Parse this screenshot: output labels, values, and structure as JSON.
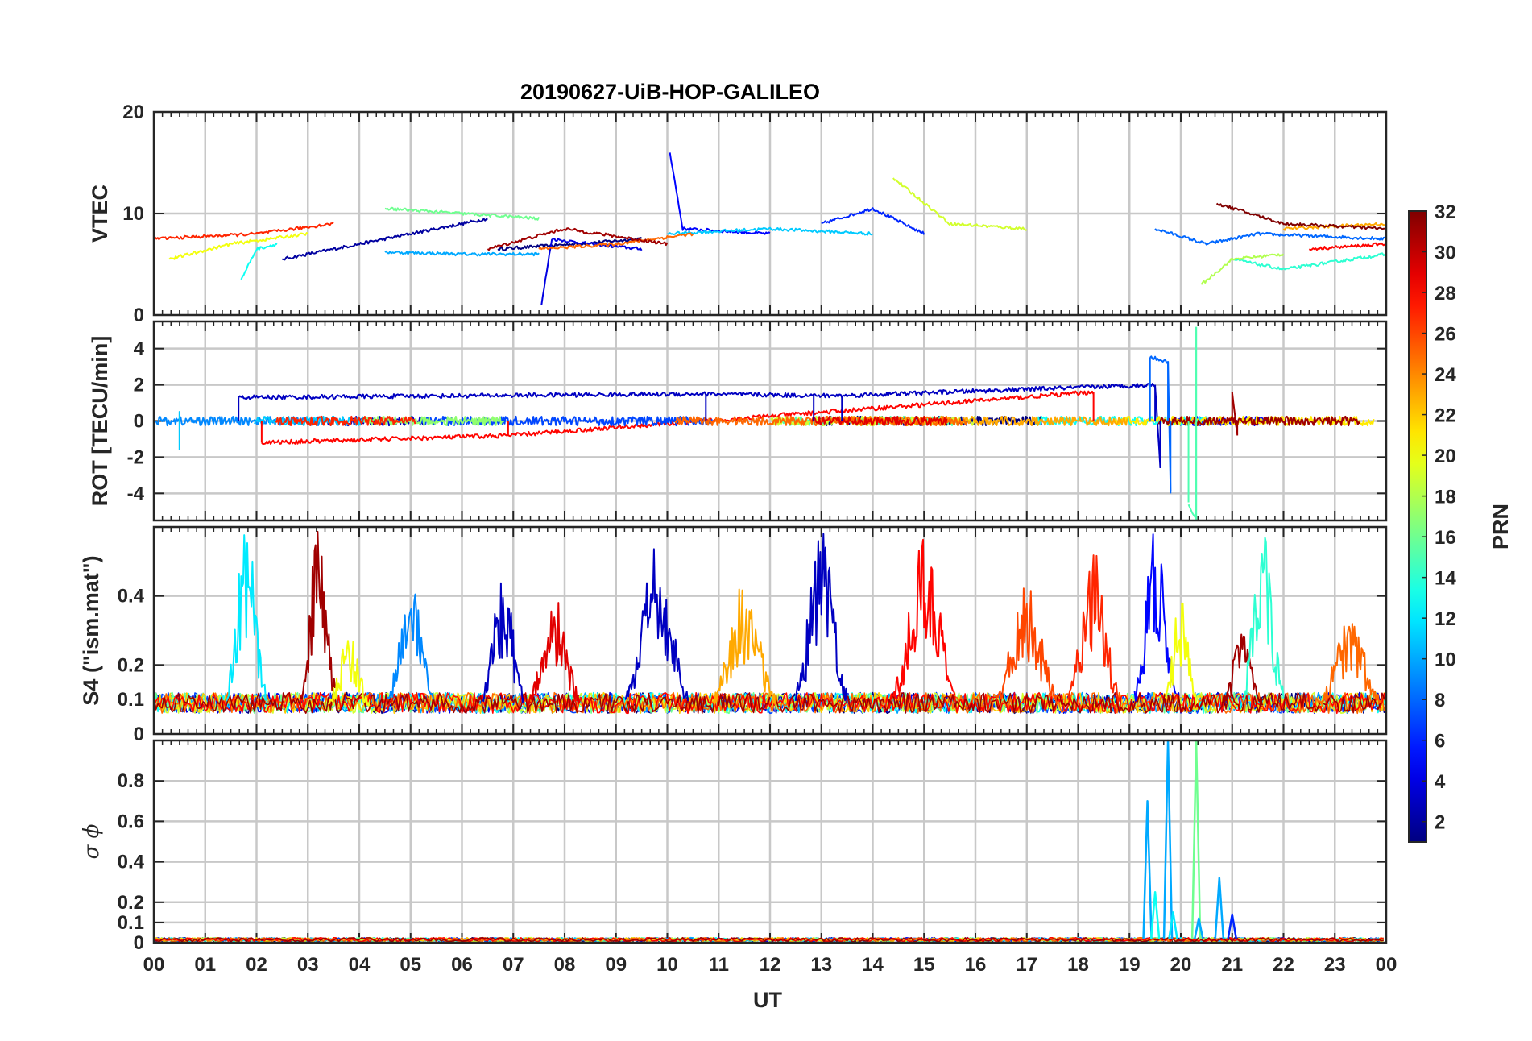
{
  "title": "20190627-UiB-HOP-GALILEO",
  "colors": {
    "background": "#ffffff",
    "axis": "#262626",
    "grid": "#c8c8c8",
    "colormap": "jet"
  },
  "chart_data": [
    {
      "type": "line",
      "panel": "VTEC",
      "ylabel": "VTEC",
      "ylim": [
        0,
        20
      ],
      "yticks": [
        "0",
        "10",
        "20"
      ],
      "xlim": [
        0,
        24
      ],
      "grid": true,
      "series": [
        {
          "prn": 1,
          "x": [
            6.7,
            8.2,
            9.5
          ],
          "y": [
            6.5,
            7.0,
            7.5
          ]
        },
        {
          "prn": 2,
          "x": [
            2.5,
            4.0,
            5.5,
            6.5
          ],
          "y": [
            5.5,
            7.0,
            8.5,
            9.5
          ]
        },
        {
          "prn": 4,
          "x": [
            7.55,
            7.75,
            8.5,
            9.5
          ],
          "y": [
            1.0,
            7.5,
            7.0,
            6.5
          ]
        },
        {
          "prn": 5,
          "x": [
            10.05,
            10.3,
            12.0
          ],
          "y": [
            16.0,
            8.5,
            8.0
          ]
        },
        {
          "prn": 6,
          "x": [
            13.0,
            14.0,
            15.0
          ],
          "y": [
            9.0,
            10.5,
            8.0
          ]
        },
        {
          "prn": 8,
          "x": [
            19.5,
            20.5,
            21.5,
            24.0
          ],
          "y": [
            8.5,
            7.0,
            8.0,
            7.5
          ]
        },
        {
          "prn": 10,
          "x": [
            4.5,
            6.0,
            7.5
          ],
          "y": [
            6.2,
            6.0,
            6.0
          ]
        },
        {
          "prn": 11,
          "x": [
            10.0,
            12.0,
            14.0
          ],
          "y": [
            8.0,
            8.5,
            8.0
          ]
        },
        {
          "prn": 13,
          "x": [
            1.7,
            2.0,
            2.4
          ],
          "y": [
            3.5,
            6.5,
            7.0
          ]
        },
        {
          "prn": 14,
          "x": [
            21.0,
            22.0,
            24.0
          ],
          "y": [
            5.5,
            4.5,
            6.0
          ]
        },
        {
          "prn": 16,
          "x": [
            4.5,
            6.0,
            7.5
          ],
          "y": [
            10.5,
            10.0,
            9.5
          ]
        },
        {
          "prn": 18,
          "x": [
            20.4,
            21.0,
            22.0
          ],
          "y": [
            3.0,
            5.5,
            6.0
          ]
        },
        {
          "prn": 19,
          "x": [
            14.4,
            15.5,
            17.0
          ],
          "y": [
            13.5,
            9.0,
            8.5
          ]
        },
        {
          "prn": 20,
          "x": [
            0.3,
            1.5,
            3.0
          ],
          "y": [
            5.5,
            7.0,
            8.0
          ]
        },
        {
          "prn": 23,
          "x": [
            22.0,
            24.0
          ],
          "y": [
            8.5,
            9.0
          ]
        },
        {
          "prn": 25,
          "x": [
            7.5,
            9.0,
            10.5
          ],
          "y": [
            6.5,
            7.0,
            8.0
          ]
        },
        {
          "prn": 27,
          "x": [
            0.0,
            2.0,
            3.5
          ],
          "y": [
            7.5,
            8.0,
            9.0
          ]
        },
        {
          "prn": 28,
          "x": [
            22.5,
            24.0
          ],
          "y": [
            6.5,
            7.0
          ]
        },
        {
          "prn": 31,
          "x": [
            6.5,
            8.0,
            10.0
          ],
          "y": [
            6.5,
            8.5,
            7.0
          ]
        },
        {
          "prn": 32,
          "x": [
            20.7,
            22.0,
            24.0
          ],
          "y": [
            11.0,
            9.0,
            8.5
          ]
        }
      ]
    },
    {
      "type": "line",
      "panel": "ROT",
      "ylabel": "ROT [TECU/min]",
      "ylim": [
        -5.5,
        5.5
      ],
      "yticks": [
        "-4",
        "-2",
        "0",
        "2",
        "4"
      ],
      "xlim": [
        0,
        24
      ],
      "grid": true,
      "series": [
        {
          "prn": 3,
          "x": [
            1.65,
            10.75,
            12.85,
            13.4,
            19.5,
            19.6
          ],
          "y": [
            1.3,
            1.5,
            1.4,
            1.4,
            2.0,
            -2.5
          ]
        },
        {
          "prn": 8,
          "x": [
            19.4,
            19.75,
            19.8
          ],
          "y": [
            3.5,
            3.3,
            -4.0
          ]
        },
        {
          "prn": 15,
          "x": [
            20.3,
            20.3,
            20.15
          ],
          "y": [
            5.2,
            -5.5,
            -4.5
          ]
        },
        {
          "prn": 11,
          "x": [
            0.5,
            0.5
          ],
          "y": [
            -1.6,
            0.5
          ]
        },
        {
          "prn": 28,
          "x": [
            2.1,
            6.9,
            18.3
          ],
          "y": [
            -1.2,
            -0.8,
            1.6
          ]
        },
        {
          "prn": 31,
          "x": [
            21.0,
            21.1
          ],
          "y": [
            1.6,
            -0.8
          ]
        }
      ]
    },
    {
      "type": "line",
      "panel": "S4",
      "ylabel": "S4 (\"ism.mat\")",
      "ylim": [
        0,
        0.6
      ],
      "yticks": [
        "0",
        "0.1",
        "0.2",
        "0.4"
      ],
      "xlim": [
        0,
        24
      ],
      "grid": true,
      "bursts": [
        {
          "prn": 12,
          "center": 1.8,
          "width": 0.8,
          "peak": 0.6
        },
        {
          "prn": 31,
          "center": 3.2,
          "width": 0.7,
          "peak": 0.6
        },
        {
          "prn": 20,
          "center": 3.8,
          "width": 0.8,
          "peak": 0.3
        },
        {
          "prn": 9,
          "center": 5.0,
          "width": 0.9,
          "peak": 0.45
        },
        {
          "prn": 3,
          "center": 6.8,
          "width": 0.8,
          "peak": 0.5
        },
        {
          "prn": 29,
          "center": 7.8,
          "width": 1.0,
          "peak": 0.4
        },
        {
          "prn": 3,
          "center": 9.8,
          "width": 1.2,
          "peak": 0.55
        },
        {
          "prn": 23,
          "center": 11.5,
          "width": 1.2,
          "peak": 0.45
        },
        {
          "prn": 3,
          "center": 13.0,
          "width": 1.0,
          "peak": 0.6
        },
        {
          "prn": 28,
          "center": 15.0,
          "width": 1.2,
          "peak": 0.6
        },
        {
          "prn": 26,
          "center": 17.0,
          "width": 1.2,
          "peak": 0.45
        },
        {
          "prn": 27,
          "center": 18.3,
          "width": 1.0,
          "peak": 0.55
        },
        {
          "prn": 5,
          "center": 19.5,
          "width": 0.8,
          "peak": 0.6
        },
        {
          "prn": 20,
          "center": 20.0,
          "width": 0.6,
          "peak": 0.42
        },
        {
          "prn": 31,
          "center": 21.2,
          "width": 0.8,
          "peak": 0.3
        },
        {
          "prn": 14,
          "center": 21.6,
          "width": 0.8,
          "peak": 0.6
        },
        {
          "prn": 25,
          "center": 23.3,
          "width": 1.2,
          "peak": 0.35
        }
      ]
    },
    {
      "type": "line",
      "panel": "sigma_phi",
      "ylabel": "σ ϕ",
      "ylim": [
        0,
        1.0
      ],
      "yticks": [
        "0",
        "0.1",
        "0.2",
        "0.4",
        "0.6",
        "0.8"
      ],
      "xlim": [
        0,
        24
      ],
      "grid": true,
      "spikes": [
        {
          "prn": 10,
          "x": 19.35,
          "peak": 0.7
        },
        {
          "prn": 13,
          "x": 19.5,
          "peak": 0.25
        },
        {
          "prn": 10,
          "x": 19.75,
          "peak": 1.0
        },
        {
          "prn": 12,
          "x": 19.85,
          "peak": 0.15
        },
        {
          "prn": 16,
          "x": 20.3,
          "peak": 1.0
        },
        {
          "prn": 10,
          "x": 20.35,
          "peak": 0.12
        },
        {
          "prn": 10,
          "x": 20.75,
          "peak": 0.32
        },
        {
          "prn": 6,
          "x": 21.0,
          "peak": 0.14
        }
      ]
    }
  ],
  "xaxis": {
    "label": "UT",
    "ticks": [
      "00",
      "01",
      "02",
      "03",
      "04",
      "05",
      "06",
      "07",
      "08",
      "09",
      "10",
      "11",
      "12",
      "13",
      "14",
      "15",
      "16",
      "17",
      "18",
      "19",
      "20",
      "21",
      "22",
      "23",
      "00"
    ]
  },
  "colorbar": {
    "label": "PRN",
    "range": [
      1,
      32
    ],
    "ticks": [
      "2",
      "4",
      "6",
      "8",
      "10",
      "12",
      "14",
      "16",
      "18",
      "20",
      "22",
      "24",
      "26",
      "28",
      "30",
      "32"
    ]
  }
}
